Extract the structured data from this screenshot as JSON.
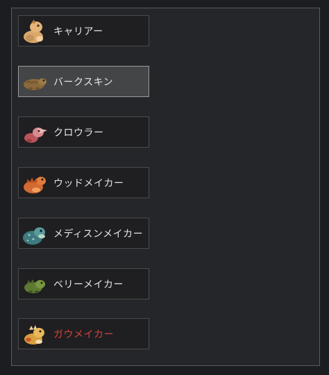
{
  "items": [
    {
      "name": "キャリアー",
      "icon": "orange-creature-icon"
    },
    {
      "name": "バークスキン",
      "icon": "brown-creature-icon",
      "selected": true
    },
    {
      "name": "クロウラー",
      "icon": "pink-creature-icon"
    },
    {
      "name": "ウッドメイカー",
      "icon": "orange-spiky-creature-icon"
    },
    {
      "name": "メディスンメイカー",
      "icon": "teal-creature-icon"
    },
    {
      "name": "ベリーメイカー",
      "icon": "green-creature-icon"
    },
    {
      "name": "ガウメイカー",
      "icon": "gold-creature-icon",
      "status": "unavailable"
    }
  ],
  "colors": {
    "label": "#e6e6e6",
    "unavailable_label": "#d4433a",
    "selected_bg": "#444546"
  }
}
